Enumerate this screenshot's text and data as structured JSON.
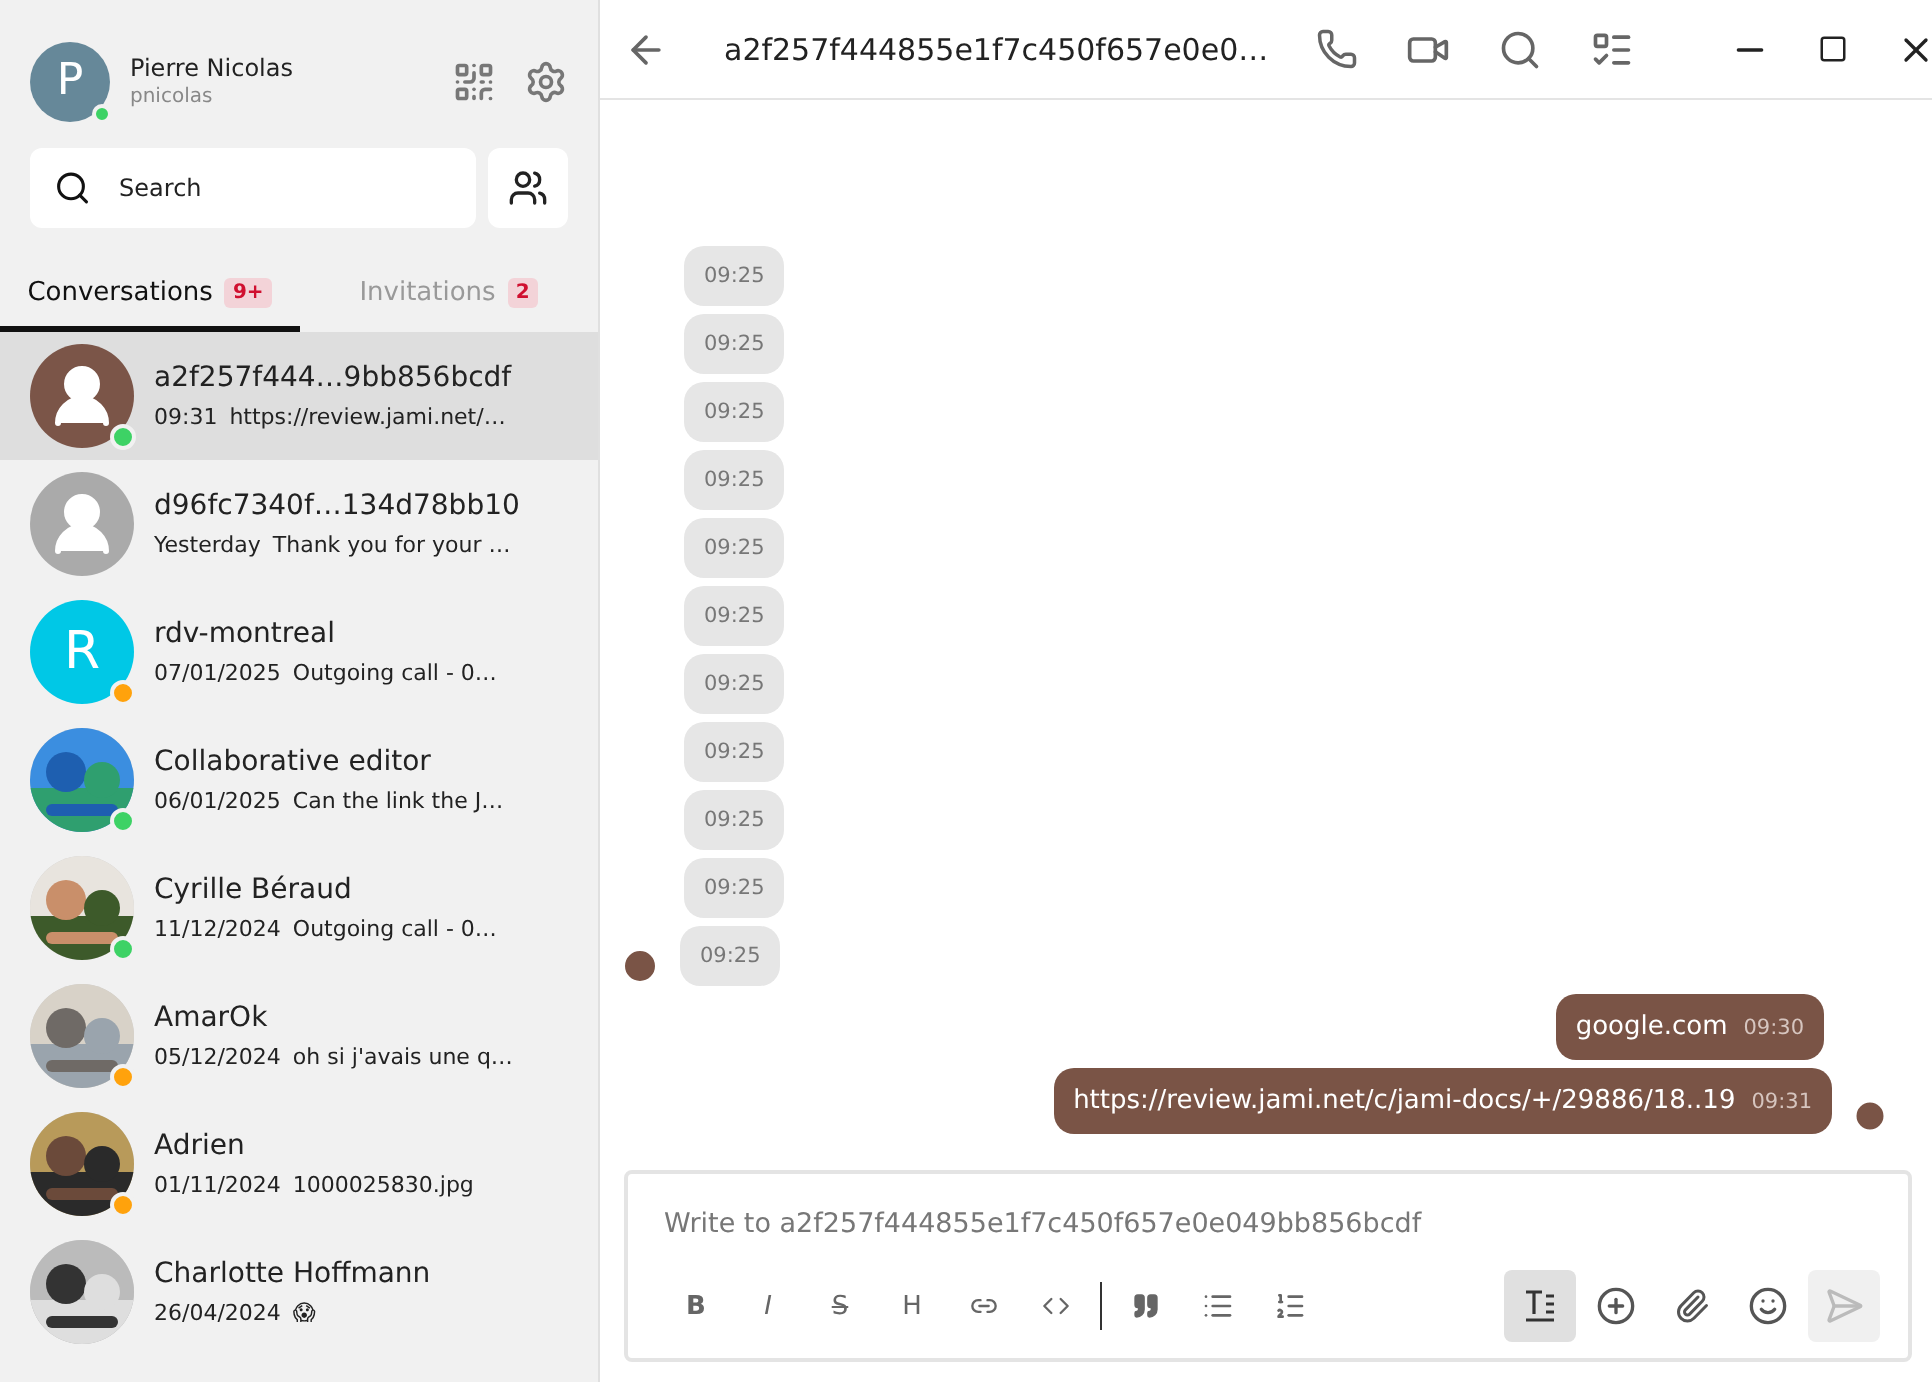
{
  "account": {
    "name": "Pierre Nicolas",
    "username": "pnicolas",
    "initial": "P",
    "online": true
  },
  "search": {
    "placeholder": "Search"
  },
  "tabs": [
    {
      "label": "Conversations",
      "badge": "9+",
      "selected": true
    },
    {
      "label": "Invitations",
      "badge": "2",
      "selected": false
    }
  ],
  "conversations": [
    {
      "title": "a2f257f444…9bb856bcdf",
      "time": "09:31",
      "preview": "https://review.jami.net/…",
      "avatar": {
        "kind": "silhouette",
        "color": "#7b5548"
      },
      "status": {
        "color": "#3dd265"
      },
      "selected": true
    },
    {
      "title": "d96fc7340f…134d78bb10",
      "time": "Yesterday",
      "preview": "Thank you for your …",
      "avatar": {
        "kind": "silhouette",
        "color": "#aaaaaa"
      },
      "selected": false
    },
    {
      "title": "rdv-montreal",
      "time": "07/01/2025",
      "preview": "Outgoing call - 0…",
      "avatar": {
        "kind": "letter",
        "letter": "R",
        "color": "#00c8e6"
      },
      "status": {
        "color": "#ffa20c"
      },
      "selected": false
    },
    {
      "title": "Collaborative editor",
      "time": "06/01/2025",
      "preview": "Can the link the J…",
      "status": {
        "color": "#3dd265"
      },
      "selected": false
    },
    {
      "title": "Cyrille Béraud",
      "time": "11/12/2024",
      "preview": "Outgoing call - 0…",
      "status": {
        "color": "#3dd265"
      },
      "selected": false
    },
    {
      "title": "AmarOk",
      "time": "05/12/2024",
      "preview": "oh si j'avais une q…",
      "status": {
        "color": "#ffa20c"
      },
      "selected": false
    },
    {
      "title": "Adrien",
      "time": "01/11/2024",
      "preview": "1000025830.jpg",
      "status": {
        "color": "#ffa20c"
      },
      "selected": false
    },
    {
      "title": "Charlotte Hoffmann",
      "time": "26/04/2024",
      "preview": "😱",
      "selected": false
    }
  ],
  "chat": {
    "title": "a2f257f444855e1f7c450f657e0e0…",
    "messages": [
      {
        "kind": "incoming",
        "time": "09:25"
      },
      {
        "kind": "incoming",
        "time": "09:25"
      },
      {
        "kind": "incoming",
        "time": "09:25"
      },
      {
        "kind": "incoming",
        "time": "09:25"
      },
      {
        "kind": "incoming",
        "time": "09:25"
      },
      {
        "kind": "incoming",
        "time": "09:25"
      },
      {
        "kind": "incoming",
        "time": "09:25"
      },
      {
        "kind": "incoming",
        "time": "09:25"
      },
      {
        "kind": "incoming",
        "time": "09:25"
      },
      {
        "kind": "incoming",
        "time": "09:25"
      },
      {
        "kind": "incoming",
        "time": "09:25",
        "avatar": true
      },
      {
        "kind": "outgoing",
        "text": "google.com",
        "time": "09:30"
      },
      {
        "kind": "outgoing",
        "text": "https://review.jami.net/c/jami-docs/+/29886/18..19",
        "time": "09:31",
        "avatar": true
      }
    ],
    "composer": {
      "placeholder": "Write to a2f257f444855e1f7c450f657e0e049bb856bcdf",
      "format_buttons": [
        "B",
        "I",
        "S",
        "H"
      ],
      "markdown_mode": true
    }
  }
}
